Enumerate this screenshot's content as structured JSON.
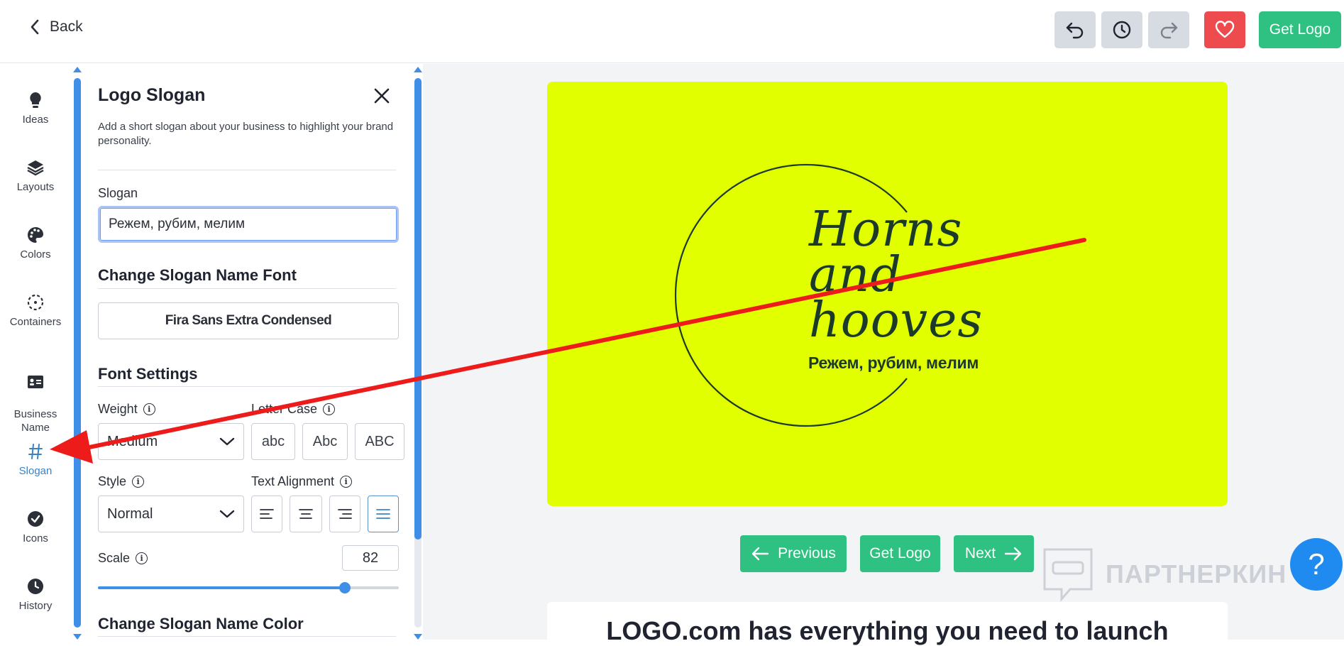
{
  "topbar": {
    "back_label": "Back",
    "get_logo_label": "Get Logo",
    "colors": {
      "grey_button": "#d7dbe2",
      "favorite": "#ee4b4f",
      "primary": "#2fc182"
    }
  },
  "rail": {
    "items": [
      {
        "label": "Ideas",
        "icon": "lightbulb-icon"
      },
      {
        "label": "Layouts",
        "icon": "layers-icon"
      },
      {
        "label": "Colors",
        "icon": "palette-icon"
      },
      {
        "label": "Containers",
        "icon": "container-icon"
      },
      {
        "label": "Business\nName",
        "icon": "id-card-icon"
      },
      {
        "label": "Slogan",
        "icon": "hash-icon",
        "active": true
      },
      {
        "label": "Icons",
        "icon": "badge-check-icon"
      },
      {
        "label": "History",
        "icon": "history-icon"
      }
    ]
  },
  "panel": {
    "title": "Logo Slogan",
    "description": "Add a short slogan about your business to highlight your brand personality.",
    "slogan_label": "Slogan",
    "slogan_value": "Режем, рубим, мелим",
    "font_section_title": "Change Slogan Name Font",
    "font_name": "Fira Sans Extra Condensed",
    "font_settings_title": "Font Settings",
    "weight_label": "Weight",
    "weight_value": "Medium",
    "letter_case_label": "Letter Case",
    "letter_case_options": [
      "abc",
      "Abc",
      "ABC"
    ],
    "style_label": "Style",
    "style_value": "Normal",
    "text_alignment_label": "Text Alignment",
    "text_alignment_selected": "justify",
    "scale_label": "Scale",
    "scale_value": "82",
    "scale_fraction": 0.82,
    "color_section_title": "Change Slogan Name Color"
  },
  "preview": {
    "background": "#e2ff00",
    "business_name_lines": [
      "Horns",
      "and",
      "hooves"
    ],
    "slogan": "Режем, рубим, мелим"
  },
  "navigation": {
    "previous_label": "Previous",
    "get_logo_label": "Get Logo",
    "next_label": "Next"
  },
  "help_label": "?",
  "watermark": "ПАРТНЕРКИН",
  "bottom_heading": "LOGO.com has everything you need to launch"
}
